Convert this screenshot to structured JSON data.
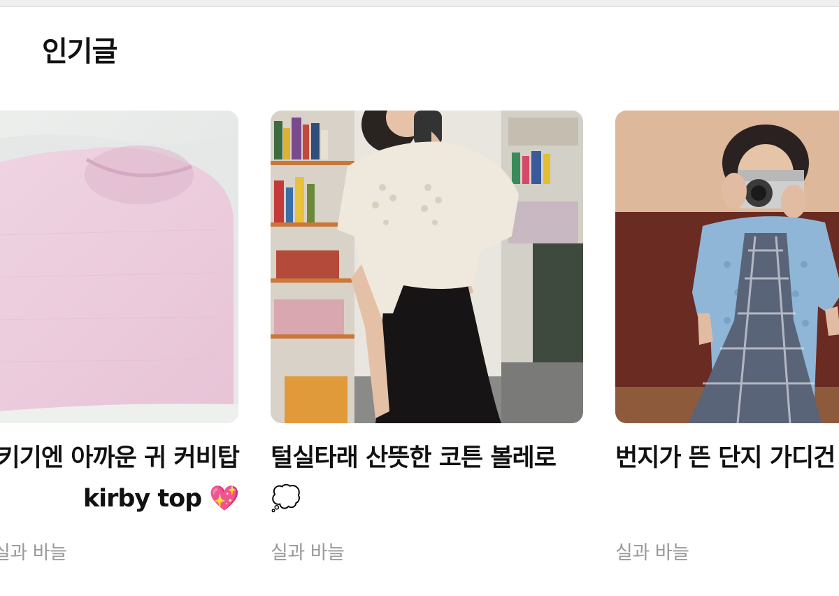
{
  "section": {
    "title": "인기글"
  },
  "posts": [
    {
      "title": "- 삼키기엔 아까운 귀 커비탑 kirby top 💖",
      "author": "실과 바늘",
      "image": "pink-knit-top"
    },
    {
      "title": "털실타래 산뜻한 코튼 볼레로 💭",
      "author": "실과 바늘",
      "image": "cream-bolero-mirror-selfie"
    },
    {
      "title": "번지가 뜬 단지 가디건",
      "author": "실과 바늘",
      "image": "blue-cardigan-camera"
    }
  ],
  "colors": {
    "title": "#111111",
    "author": "#9a9a9a",
    "background": "#ffffff"
  }
}
